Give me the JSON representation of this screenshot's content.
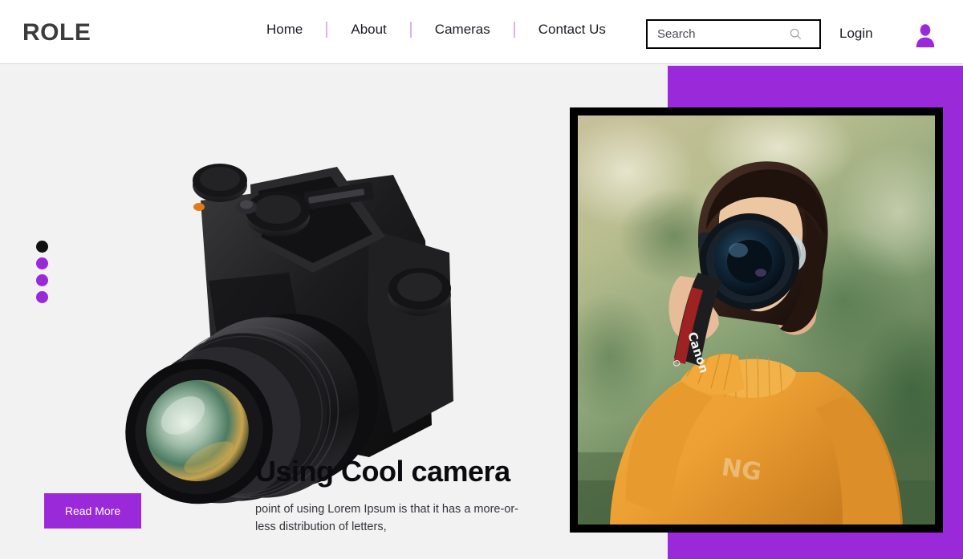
{
  "header": {
    "logo": "ROLE",
    "nav": [
      {
        "label": "Home",
        "name": "nav-item-home"
      },
      {
        "label": "About",
        "name": "nav-item-about"
      },
      {
        "label": "Cameras",
        "name": "nav-item-cameras"
      },
      {
        "label": "Contact Us",
        "name": "nav-item-contact-us"
      }
    ],
    "search": {
      "placeholder": "Search",
      "value": "",
      "icon": "search-icon"
    },
    "login_label": "Login",
    "avatar_icon": "user-avatar-icon"
  },
  "hero": {
    "title": "Using Cool camera",
    "subtitle": "point of using Lorem Ipsum is that it has a more-or-less distribution of letters,",
    "cta_label": "Read More",
    "carousel_dots": [
      {
        "active": true,
        "color": "#111111"
      },
      {
        "active": false,
        "color": "#9a2ad9"
      },
      {
        "active": false,
        "color": "#9a2ad9"
      },
      {
        "active": false,
        "color": "#9a2ad9"
      }
    ],
    "product_image_alt": "Fujifilm mirrorless camera with FUJINON XF 18-55mm lens",
    "framed_photo_alt": "Woman in orange sweater holding a Canon DSLR camera outdoors"
  },
  "colors": {
    "accent_purple": "#9a2ad9",
    "nav_divider": "#d9b3ef",
    "page_background": "#f2f2f2",
    "header_background": "#ffffff",
    "logo_text": "#3c3c3c",
    "heading_text": "#0b0b0f",
    "frame_border": "#000000"
  }
}
